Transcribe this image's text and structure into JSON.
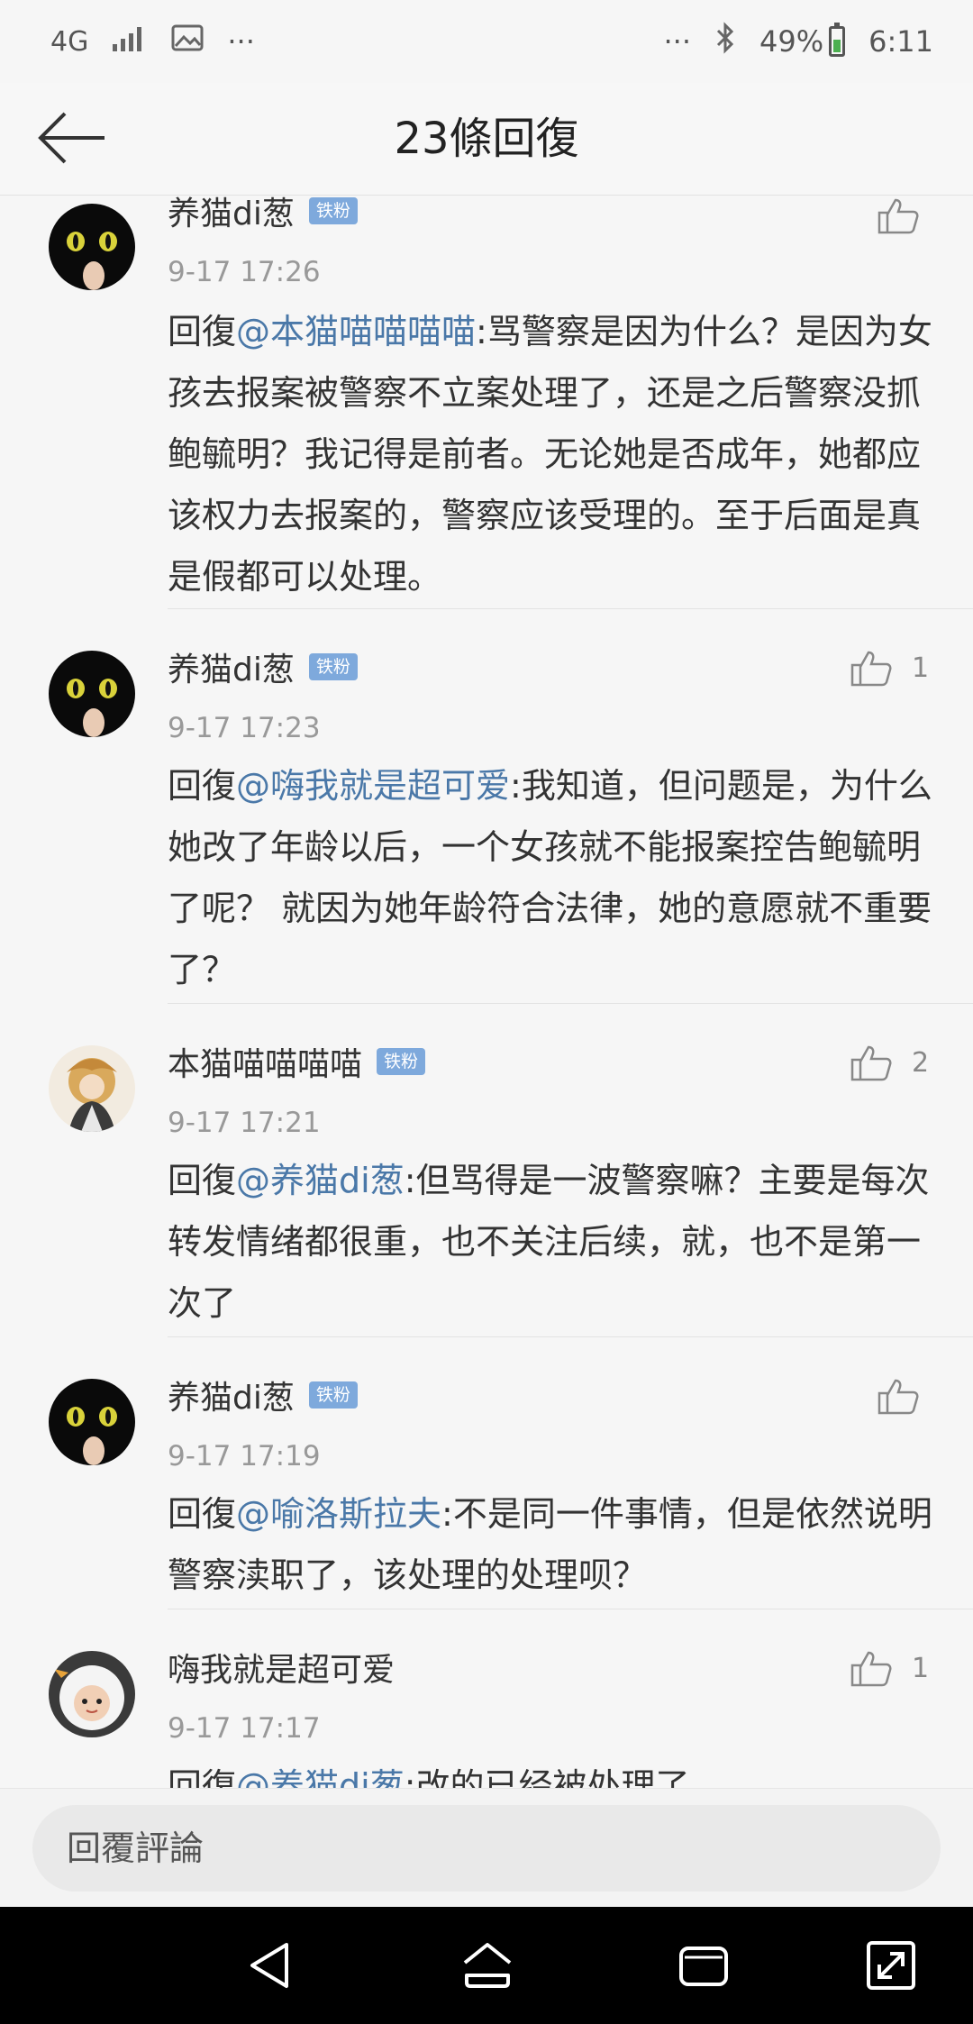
{
  "status_bar": {
    "network": "4G",
    "battery_percent": "49%",
    "time": "6:11",
    "icons": [
      "signal-icon",
      "gallery-icon",
      "more-icon",
      "bluetooth-icon",
      "battery-icon"
    ]
  },
  "header": {
    "title": "23條回復"
  },
  "comments": [
    {
      "user": "养猫di葱",
      "badge": "铁粉",
      "time": "9-17 17:26",
      "reply_prefix": "回復",
      "mention": "@本猫喵喵喵喵",
      "text": ":骂警察是因为什么？是因为女孩去报案被警察不立案处理了，还是之后警察没抓鲍毓明？我记得是前者。无论她是否成年，她都应该权力去报案的，警察应该受理的。至于后面是真是假都可以处理。",
      "likes": ""
    },
    {
      "user": "养猫di葱",
      "badge": "铁粉",
      "time": "9-17 17:23",
      "reply_prefix": "回復",
      "mention": "@嗨我就是超可爱",
      "text": ":我知道，但问题是，为什么她改了年龄以后，一个女孩就不能报案控告鲍毓明了呢？ 就因为她年龄符合法律，她的意愿就不重要了？",
      "likes": "1"
    },
    {
      "user": "本猫喵喵喵喵",
      "badge": "铁粉",
      "time": "9-17 17:21",
      "reply_prefix": "回復",
      "mention": "@养猫di葱",
      "text": ":但骂得是一波警察嘛？主要是每次转发情绪都很重，也不关注后续，就，也不是第一次了",
      "likes": "2"
    },
    {
      "user": "养猫di葱",
      "badge": "铁粉",
      "time": "9-17 17:19",
      "reply_prefix": "回復",
      "mention": "@喻洛斯拉夫",
      "text": ":不是同一件事情，但是依然说明警察渎职了，该处理的处理呗？",
      "likes": ""
    },
    {
      "user": "嗨我就是超可爱",
      "badge": "",
      "time": "9-17 17:17",
      "reply_prefix": "回復",
      "mention": "@养猫di葱",
      "text": ":改的已经被处理了",
      "likes": "1"
    }
  ],
  "composer": {
    "placeholder": "回覆評論"
  },
  "colors": {
    "mention": "#4a78a8",
    "badge": "#7ea9dc",
    "background": "#f6f6f6"
  }
}
